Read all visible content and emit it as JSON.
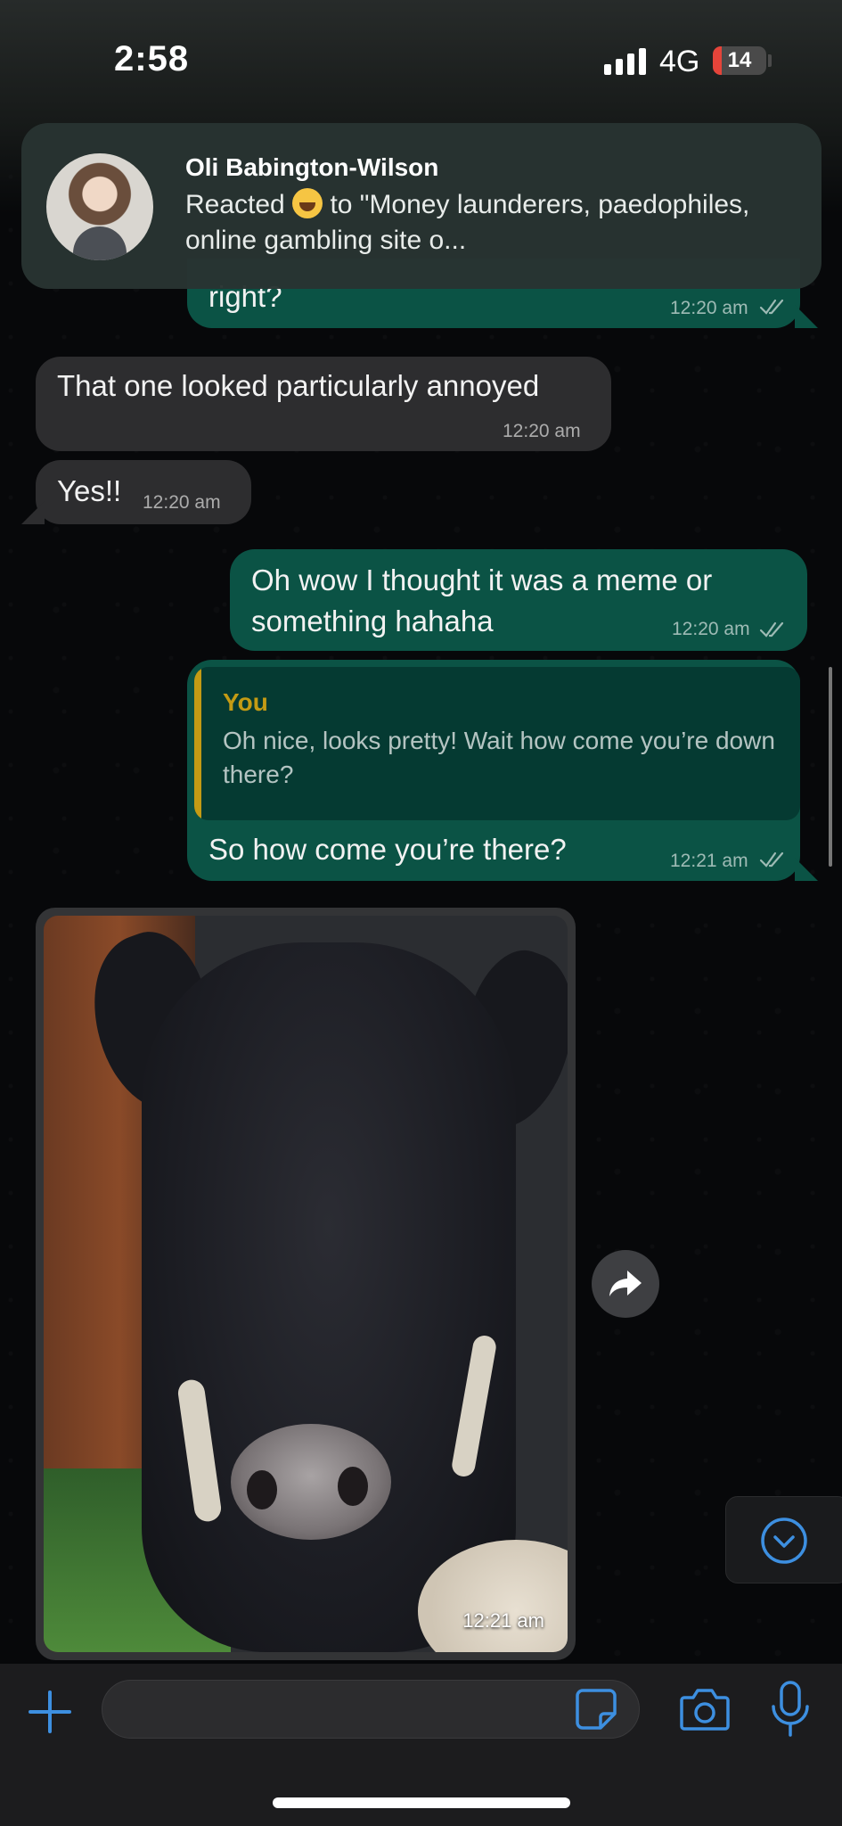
{
  "status_bar": {
    "time": "2:58",
    "network": "4G",
    "battery": "14"
  },
  "notification": {
    "sender": "Oli Babington-Wilson",
    "body_prefix": "Reacted",
    "body_suffix": "to \"Money launderers, paedophiles, online gambling site o...",
    "emoji": "face-with-tears-of-joy"
  },
  "messages": [
    {
      "direction": "outgoing",
      "text": "right?",
      "time": "12:20 am",
      "status": "read"
    },
    {
      "direction": "incoming",
      "text": "That one looked particularly annoyed",
      "time": "12:20 am"
    },
    {
      "direction": "incoming",
      "text": "Yes!!",
      "time": "12:20 am"
    },
    {
      "direction": "outgoing",
      "text": "Oh wow I thought it was a meme or something hahaha",
      "time": "12:20 am",
      "status": "read"
    },
    {
      "direction": "outgoing",
      "reply_to": {
        "author": "You",
        "text": "Oh nice, looks pretty! Wait how come you’re down there?"
      },
      "text": "So how come you’re there?",
      "time": "12:21 am",
      "status": "read"
    },
    {
      "direction": "incoming",
      "type": "image",
      "image_subject": "cow",
      "time": "12:21 am"
    }
  ],
  "input": {
    "placeholder": "",
    "value": ""
  },
  "colors": {
    "outgoing_bubble": "#0b5345",
    "incoming_bubble": "#2d2d2f",
    "accent": "#3d8fe0",
    "reply_author": "#c49b14"
  }
}
